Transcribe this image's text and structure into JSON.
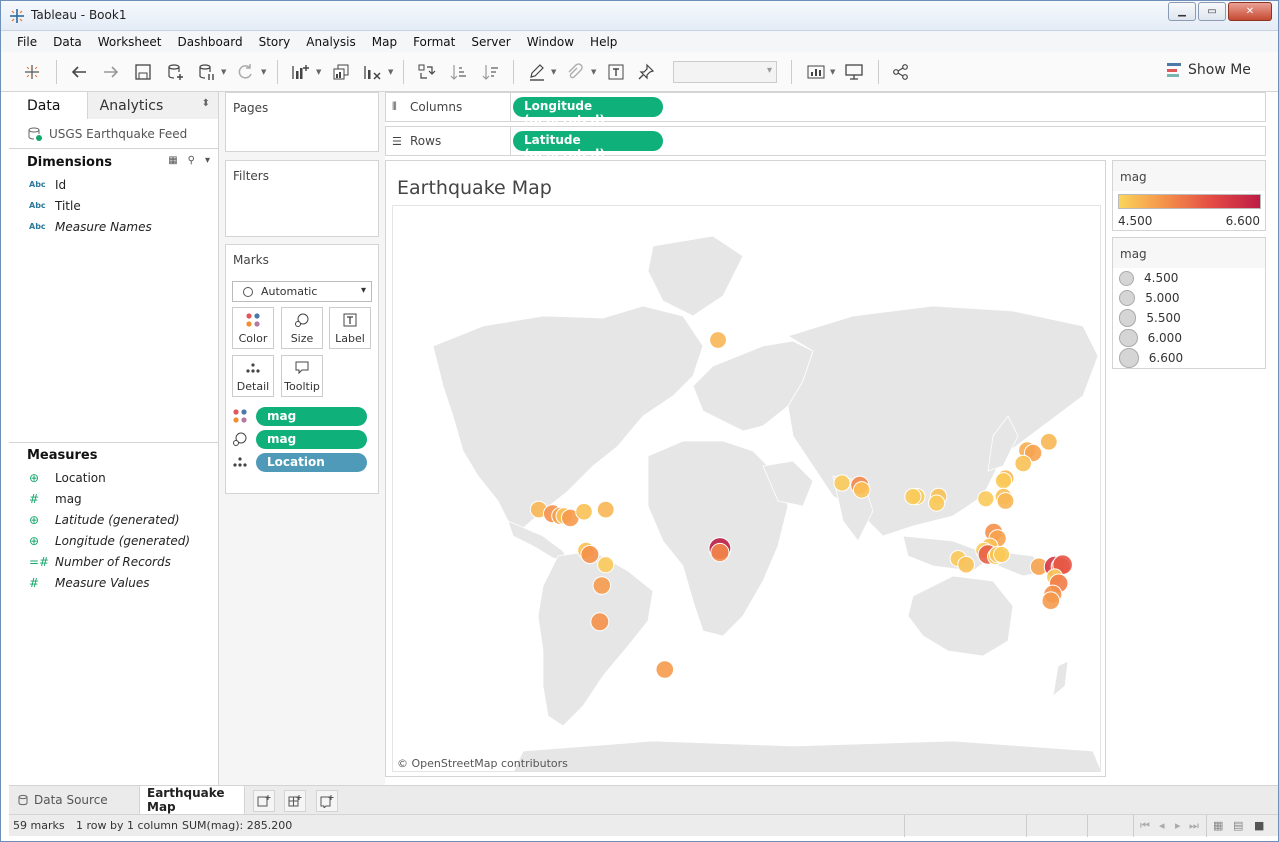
{
  "window": {
    "title": "Tableau - Book1"
  },
  "menu": [
    "File",
    "Data",
    "Worksheet",
    "Dashboard",
    "Story",
    "Analysis",
    "Map",
    "Format",
    "Server",
    "Window",
    "Help"
  ],
  "toolbar": {
    "show_me_label": "Show Me"
  },
  "data_pane": {
    "tabs": [
      "Data",
      "Analytics"
    ],
    "source": "USGS Earthquake Feed",
    "dimensions_title": "Dimensions",
    "dimensions": [
      {
        "icon": "Abc",
        "name": "Id",
        "italic": false
      },
      {
        "icon": "Abc",
        "name": "Title",
        "italic": false
      },
      {
        "icon": "Abc",
        "name": "Measure Names",
        "italic": true
      }
    ],
    "measures_title": "Measures",
    "measures": [
      {
        "icon": "globe",
        "name": "Location",
        "italic": false
      },
      {
        "icon": "#",
        "name": "mag",
        "italic": false
      },
      {
        "icon": "globe",
        "name": "Latitude (generated)",
        "italic": true
      },
      {
        "icon": "globe",
        "name": "Longitude (generated)",
        "italic": true
      },
      {
        "icon": "=#",
        "name": "Number of Records",
        "italic": true
      },
      {
        "icon": "#",
        "name": "Measure Values",
        "italic": true
      }
    ]
  },
  "cards": {
    "pages": "Pages",
    "filters": "Filters",
    "marks": "Marks",
    "mark_type": "Automatic",
    "mark_buttons": [
      "Color",
      "Size",
      "Label",
      "Detail",
      "Tooltip"
    ],
    "mark_pills": [
      {
        "kind": "color",
        "label": "mag"
      },
      {
        "kind": "size",
        "label": "mag"
      },
      {
        "kind": "detail",
        "label": "Location"
      }
    ]
  },
  "shelves": {
    "columns_label": "Columns",
    "columns_pill": "Longitude (generated)",
    "rows_label": "Rows",
    "rows_pill": "Latitude (generated)"
  },
  "viz": {
    "title": "Earthquake Map",
    "attribution": "© OpenStreetMap contributors",
    "points": [
      {
        "lon": 142,
        "lat": 43,
        "mag": 4.9
      },
      {
        "lon": 145,
        "lat": 42,
        "mag": 5.0
      },
      {
        "lon": 153,
        "lat": 46,
        "mag": 4.8
      },
      {
        "lon": -15,
        "lat": 71,
        "mag": 4.8
      },
      {
        "lon": 140,
        "lat": 38,
        "mag": 4.7
      },
      {
        "lon": 131,
        "lat": 32,
        "mag": 4.8
      },
      {
        "lon": 130,
        "lat": 31,
        "mag": 4.6
      },
      {
        "lon": 130,
        "lat": 24,
        "mag": 4.7
      },
      {
        "lon": 131,
        "lat": 22,
        "mag": 4.8
      },
      {
        "lon": 121,
        "lat": 23,
        "mag": 4.6
      },
      {
        "lon": 57,
        "lat": 29,
        "mag": 5.3
      },
      {
        "lon": 58,
        "lat": 27,
        "mag": 4.7
      },
      {
        "lon": 48,
        "lat": 30,
        "mag": 4.6
      },
      {
        "lon": 86,
        "lat": 24,
        "mag": 4.6
      },
      {
        "lon": 97,
        "lat": 24,
        "mag": 4.7
      },
      {
        "lon": 96,
        "lat": 21,
        "mag": 4.6
      },
      {
        "lon": -106,
        "lat": 18,
        "mag": 4.8
      },
      {
        "lon": -99,
        "lat": 16,
        "mag": 5.2
      },
      {
        "lon": -95,
        "lat": 15,
        "mag": 5.0
      },
      {
        "lon": -93,
        "lat": 15,
        "mag": 4.7
      },
      {
        "lon": -90,
        "lat": 14,
        "mag": 5.1
      },
      {
        "lon": -83,
        "lat": 17,
        "mag": 4.7
      },
      {
        "lon": -72,
        "lat": 18,
        "mag": 4.8
      },
      {
        "lon": -14,
        "lat": -1,
        "mag": 6.6
      },
      {
        "lon": -14,
        "lat": -3,
        "mag": 5.3
      },
      {
        "lon": 125,
        "lat": 7,
        "mag": 5.2
      },
      {
        "lon": 127,
        "lat": 4,
        "mag": 5.0
      },
      {
        "lon": 123,
        "lat": 0,
        "mag": 4.7
      },
      {
        "lon": 120,
        "lat": -2,
        "mag": 4.6
      },
      {
        "lon": 107,
        "lat": -6,
        "mag": 4.6
      },
      {
        "lon": 111,
        "lat": -9,
        "mag": 4.7
      },
      {
        "lon": 122,
        "lat": -4,
        "mag": 5.7
      },
      {
        "lon": 126,
        "lat": -5,
        "mag": 4.6
      },
      {
        "lon": 127,
        "lat": -4,
        "mag": 4.7
      },
      {
        "lon": 129,
        "lat": -4,
        "mag": 4.6
      },
      {
        "lon": -82,
        "lat": -2,
        "mag": 4.7
      },
      {
        "lon": -80,
        "lat": -4,
        "mag": 5.2
      },
      {
        "lon": -72,
        "lat": -9,
        "mag": 4.6
      },
      {
        "lon": -74,
        "lat": -19,
        "mag": 5.1
      },
      {
        "lon": -75,
        "lat": -35,
        "mag": 5.2
      },
      {
        "lon": -42,
        "lat": -52,
        "mag": 5.1
      },
      {
        "lon": 148,
        "lat": -10,
        "mag": 5.0
      },
      {
        "lon": 156,
        "lat": -10,
        "mag": 6.2
      },
      {
        "lon": 159,
        "lat": -10,
        "mag": 5.5
      },
      {
        "lon": 160,
        "lat": -9,
        "mag": 5.8
      },
      {
        "lon": 156,
        "lat": -15,
        "mag": 4.6
      },
      {
        "lon": 158,
        "lat": -18,
        "mag": 5.4
      },
      {
        "lon": 155,
        "lat": -23,
        "mag": 5.2
      },
      {
        "lon": 154,
        "lat": -26,
        "mag": 5.1
      },
      {
        "lon": 84,
        "lat": 24,
        "mag": 4.6
      }
    ]
  },
  "legends": {
    "color_title": "mag",
    "color_min": "4.500",
    "color_max": "6.600",
    "size_title": "mag",
    "sizes": [
      "4.500",
      "5.000",
      "5.500",
      "6.000",
      "6.600"
    ]
  },
  "tabs": {
    "data_source": "Data Source",
    "sheet": "Earthquake Map"
  },
  "status": {
    "marks": "59 marks",
    "dims": "1 row by 1 column",
    "sum": "SUM(mag): 285.200"
  }
}
